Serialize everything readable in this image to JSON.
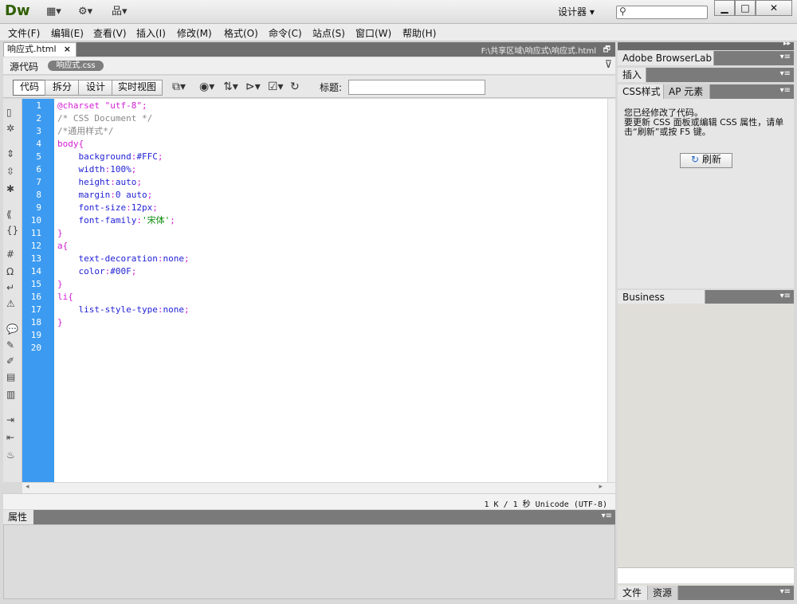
{
  "app": {
    "logo": "Dw",
    "workspace": "设计器",
    "search_placeholder": "",
    "window_controls": [
      "▁",
      "□",
      "✕"
    ]
  },
  "menu": [
    "文件(F)",
    "编辑(E)",
    "查看(V)",
    "插入(I)",
    "修改(M)",
    "格式(O)",
    "命令(C)",
    "站点(S)",
    "窗口(W)",
    "帮助(H)"
  ],
  "document": {
    "tab_name": "响应式.html",
    "path": "F:\\共享区域\\响应式\\响应式.html",
    "source_label": "源代码",
    "related_file": "响应式.css",
    "view_buttons": [
      "代码",
      "拆分",
      "设计",
      "实时视图"
    ],
    "title_label": "标题:",
    "title_value": ""
  },
  "code": {
    "line_numbers": [
      "1",
      "2",
      "3",
      "4",
      "5",
      "6",
      "7",
      "8",
      "9",
      "10",
      "11",
      "12",
      "13",
      "14",
      "15",
      "16",
      "17",
      "18",
      "19",
      "20"
    ],
    "lines": [
      [
        {
          "t": "@charset \"utf-8\";",
          "c": "purple"
        }
      ],
      [
        {
          "t": "/* CSS Document */",
          "c": "gray"
        }
      ],
      [
        {
          "t": "/*通用样式*/",
          "c": "gray"
        }
      ],
      [
        {
          "t": "body{",
          "c": "purple"
        }
      ],
      [
        {
          "t": "    background",
          "c": "blue"
        },
        {
          "t": ":",
          "c": "purple"
        },
        {
          "t": "#FFC",
          "c": "blue"
        },
        {
          "t": ";",
          "c": "purple"
        }
      ],
      [
        {
          "t": "    width",
          "c": "blue"
        },
        {
          "t": ":",
          "c": "purple"
        },
        {
          "t": "100%",
          "c": "blue"
        },
        {
          "t": ";",
          "c": "purple"
        }
      ],
      [
        {
          "t": "    height",
          "c": "blue"
        },
        {
          "t": ":",
          "c": "purple"
        },
        {
          "t": "auto",
          "c": "blue"
        },
        {
          "t": ";",
          "c": "purple"
        }
      ],
      [
        {
          "t": "    margin",
          "c": "blue"
        },
        {
          "t": ":",
          "c": "purple"
        },
        {
          "t": "0 auto",
          "c": "blue"
        },
        {
          "t": ";",
          "c": "purple"
        }
      ],
      [
        {
          "t": "    font-size",
          "c": "blue"
        },
        {
          "t": ":",
          "c": "purple"
        },
        {
          "t": "12px",
          "c": "blue"
        },
        {
          "t": ";",
          "c": "purple"
        }
      ],
      [
        {
          "t": "    font-family",
          "c": "blue"
        },
        {
          "t": ":",
          "c": "purple"
        },
        {
          "t": "'宋体'",
          "c": "green"
        },
        {
          "t": ";",
          "c": "purple"
        }
      ],
      [
        {
          "t": "}",
          "c": "purple"
        }
      ],
      [
        {
          "t": "a{",
          "c": "purple"
        }
      ],
      [
        {
          "t": "    text-decoration",
          "c": "blue"
        },
        {
          "t": ":",
          "c": "purple"
        },
        {
          "t": "none",
          "c": "blue"
        },
        {
          "t": ";",
          "c": "purple"
        }
      ],
      [
        {
          "t": "    color",
          "c": "blue"
        },
        {
          "t": ":",
          "c": "purple"
        },
        {
          "t": "#00F",
          "c": "blue"
        },
        {
          "t": ";",
          "c": "purple"
        }
      ],
      [
        {
          "t": "}",
          "c": "purple"
        }
      ],
      [
        {
          "t": "li{",
          "c": "purple"
        }
      ],
      [
        {
          "t": "    list-style-type",
          "c": "blue"
        },
        {
          "t": ":",
          "c": "purple"
        },
        {
          "t": "none",
          "c": "blue"
        },
        {
          "t": ";",
          "c": "purple"
        }
      ],
      [
        {
          "t": "}",
          "c": "purple"
        }
      ],
      [],
      []
    ]
  },
  "status": {
    "info": "1 K / 1 秒  Unicode (UTF-8)"
  },
  "properties": {
    "tab": "属性"
  },
  "panels": {
    "browserlab": "Adobe BrowserLab",
    "insert": "插入",
    "css_tab": "CSS样式",
    "ap_tab": "AP 元素",
    "css_message": "您已经修改了代码。\n要更新 CSS 面板或编辑 CSS 属性，请单击“刷新”或按 F5 键。",
    "refresh_label": "刷新",
    "business_catalyst": "Business Catalyst",
    "files_tab": "文件",
    "assets_tab": "资源"
  },
  "colors": {
    "gutter": "#3c9bf0",
    "code_purple": "#d41dd4",
    "code_blue": "#2222d6",
    "code_gray": "#888888",
    "code_green": "#0a8a0a"
  },
  "icons": [
    "layout-icon",
    "gear-icon",
    "site-icon",
    "search-icon",
    "filter-icon",
    "refresh-icon"
  ]
}
